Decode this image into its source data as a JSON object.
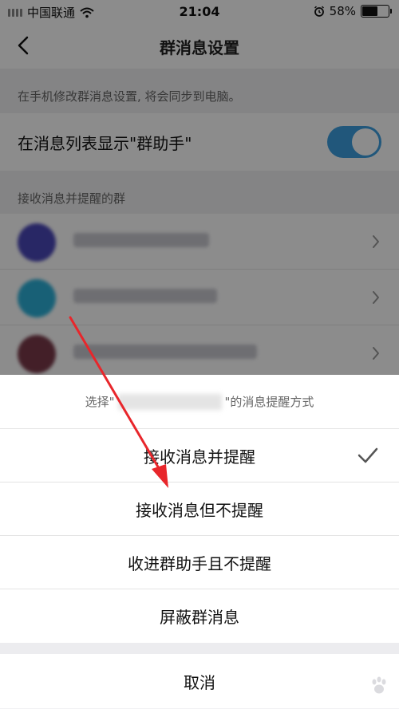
{
  "status_bar": {
    "carrier": "中国联通",
    "time": "21:04",
    "battery_percent": "58%",
    "battery_level": 0.58
  },
  "nav": {
    "title": "群消息设置"
  },
  "settings": {
    "sync_hint": "在手机修改群消息设置, 将会同步到电脑。",
    "assistant_toggle_label": "在消息列表显示\"群助手\"",
    "assistant_toggle_on": true,
    "section_label": "接收消息并提醒的群"
  },
  "groups": [
    {
      "avatar_color": "#4a47b8",
      "name_width": 170
    },
    {
      "avatar_color": "#2db0d8",
      "name_width": 180
    },
    {
      "avatar_color": "#7a3a4a",
      "name_width": 230
    }
  ],
  "action_sheet": {
    "header_prefix": "选择\"",
    "header_suffix": "\"的消息提醒方式",
    "options": [
      {
        "label": "接收消息并提醒",
        "selected": true
      },
      {
        "label": "接收消息但不提醒",
        "selected": false
      },
      {
        "label": "收进群助手且不提醒",
        "selected": false
      },
      {
        "label": "屏蔽群消息",
        "selected": false
      }
    ],
    "cancel_label": "取消"
  },
  "colors": {
    "toggle_on": "#3c9fe0",
    "annotation_arrow": "#e8262b"
  },
  "icons": {
    "back": "chevron-left-icon",
    "wifi": "wifi-icon",
    "alarm": "alarm-icon",
    "check": "checkmark-icon",
    "chevron": "chevron-right-icon"
  }
}
